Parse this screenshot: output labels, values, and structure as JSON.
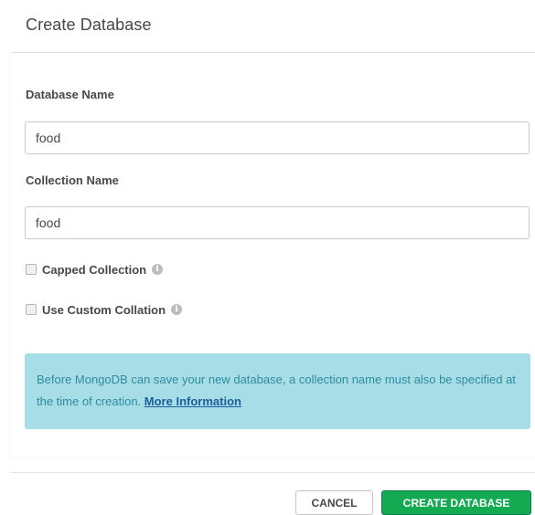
{
  "dialog": {
    "title": "Create Database"
  },
  "form": {
    "database_name": {
      "label": "Database Name",
      "value": "food"
    },
    "collection_name": {
      "label": "Collection Name",
      "value": "food"
    },
    "capped_collection": {
      "label": "Capped Collection",
      "checked": false,
      "info_icon": "info-circle-icon"
    },
    "custom_collation": {
      "label": "Use Custom Collation",
      "checked": false,
      "info_icon": "info-circle-icon"
    }
  },
  "notice": {
    "text": "Before MongoDB can save your new database, a collection name must also be specified at the time of creation. ",
    "link_label": "More Information"
  },
  "footer": {
    "cancel_label": "Cancel",
    "create_label": "Create Database"
  },
  "colors": {
    "primary_button": "#13aa52",
    "notice_background": "#a6dde6",
    "notice_text": "#2f8ca0",
    "link": "#1d5f9c"
  }
}
